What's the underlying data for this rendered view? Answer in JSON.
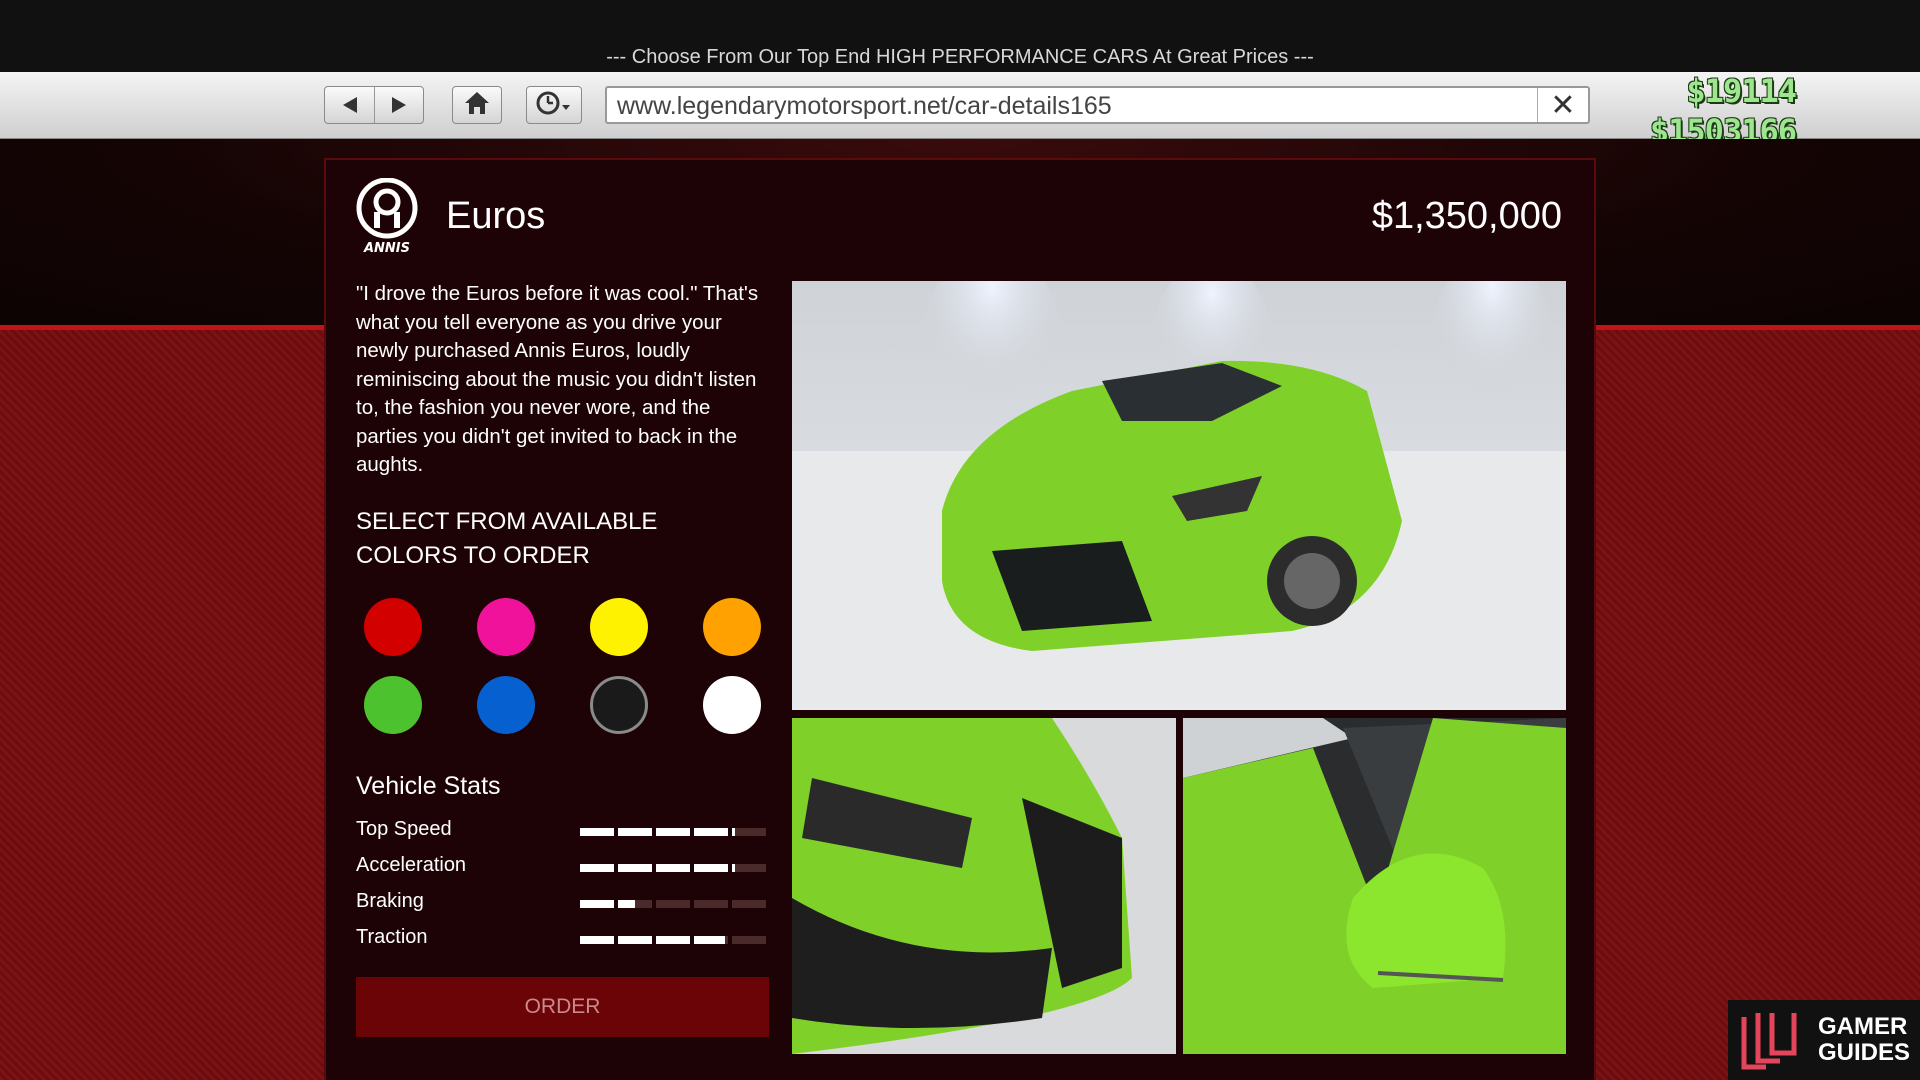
{
  "tagline": "--- Choose From Our Top End HIGH PERFORMANCE CARS At Great Prices ---",
  "browser": {
    "url": "www.legendarymotorsport.net/car-details165",
    "icons": [
      "back-arrow-icon",
      "forward-arrow-icon",
      "home-icon",
      "history-clock-icon",
      "close-icon"
    ]
  },
  "money": {
    "cash": "$19114",
    "bank": "$1503166"
  },
  "car": {
    "brand_logo": "annis-logo",
    "brand_word": "ANNIS",
    "name": "Euros",
    "price": "$1,350,000",
    "description": "\"I drove the Euros before it was cool.\" That's what you tell everyone as you drive your newly purchased Annis Euros, loudly reminiscing about the music you didn't listen to, the fashion you never wore, and the parties you didn't get invited to back in the aughts."
  },
  "colors": {
    "heading": "SELECT FROM AVAILABLE COLORS TO ORDER",
    "swatches": [
      "#d30000",
      "#f0129b",
      "#fff200",
      "#ffa100",
      "#4cc22f",
      "#0760d0",
      "#1a1a1a",
      "#ffffff"
    ],
    "selected": 6
  },
  "stats": {
    "title": "Vehicle Stats",
    "items": [
      {
        "label": "Top Speed",
        "value": 0.82
      },
      {
        "label": "Acceleration",
        "value": 0.82
      },
      {
        "label": "Braking",
        "value": 0.3
      },
      {
        "label": "Traction",
        "value": 0.78
      }
    ]
  },
  "order_label": "ORDER",
  "images": [
    {
      "name": "car-front-quarter-photo",
      "paint": "#7fd12a"
    },
    {
      "name": "car-headlight-detail-photo",
      "paint": "#7fd12a"
    },
    {
      "name": "car-mirror-detail-photo",
      "paint": "#7fd12a"
    }
  ],
  "watermark": {
    "line1": "GAMER",
    "line2": "GUIDES"
  }
}
